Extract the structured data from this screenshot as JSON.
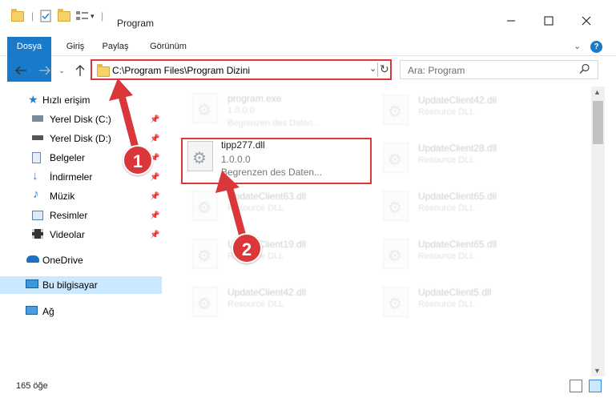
{
  "window": {
    "title": "Program",
    "minimize_icon": "minimize-icon",
    "maximize_icon": "maximize-icon",
    "close_icon": "close-icon"
  },
  "ribbon": {
    "tabs": [
      "Dosya",
      "Giriş",
      "Paylaş",
      "Görünüm"
    ]
  },
  "address": {
    "path": "C:\\Program Files\\Program Dizini",
    "search_placeholder": "Ara: Program"
  },
  "nav": {
    "quick_access": "Hızlı erişim",
    "items": [
      {
        "label": "Yerel Disk (C:)",
        "icon": "drive-icon",
        "pinned": true
      },
      {
        "label": "Yerel Disk (D:)",
        "icon": "drive-icon",
        "pinned": true
      },
      {
        "label": "Belgeler",
        "icon": "documents-icon",
        "pinned": true
      },
      {
        "label": "İndirmeler",
        "icon": "download-icon",
        "pinned": true
      },
      {
        "label": "Müzik",
        "icon": "music-icon",
        "pinned": true
      },
      {
        "label": "Resimler",
        "icon": "pictures-icon",
        "pinned": true
      },
      {
        "label": "Videolar",
        "icon": "videos-icon",
        "pinned": true
      }
    ],
    "onedrive": "OneDrive",
    "this_pc": "Bu bilgisayar",
    "network": "Ağ"
  },
  "files": {
    "highlighted": {
      "name": "tipp277.dll",
      "version": "1.0.0.0",
      "description": "Begrenzen des Daten..."
    },
    "left_column": [
      {
        "name": "program.exe",
        "line2": "1.0.0.0",
        "line3": "Begrenzen des Daten..."
      },
      {
        "name": "UpdateClient63.dll",
        "line2": "Resource DLL"
      },
      {
        "name": "UpdateClient19.dll",
        "line2": "Resource DLL"
      },
      {
        "name": "UpdateClient42.dll",
        "line2": "Resource DLL"
      }
    ],
    "right_column": [
      {
        "name": "UpdateClient42.dll",
        "line2": "Resource DLL"
      },
      {
        "name": "UpdateClient28.dll",
        "line2": "Resource DLL"
      },
      {
        "name": "UpdateClient65.dll",
        "line2": "Resource DLL"
      },
      {
        "name": "UpdateClient65.dll",
        "line2": "Resource DLL"
      },
      {
        "name": "UpdateClient5.dll",
        "line2": "Resource DLL"
      }
    ]
  },
  "annotations": {
    "step1": "1",
    "step2": "2",
    "color": "#d9373a"
  },
  "status": {
    "count": "165 öğe"
  }
}
